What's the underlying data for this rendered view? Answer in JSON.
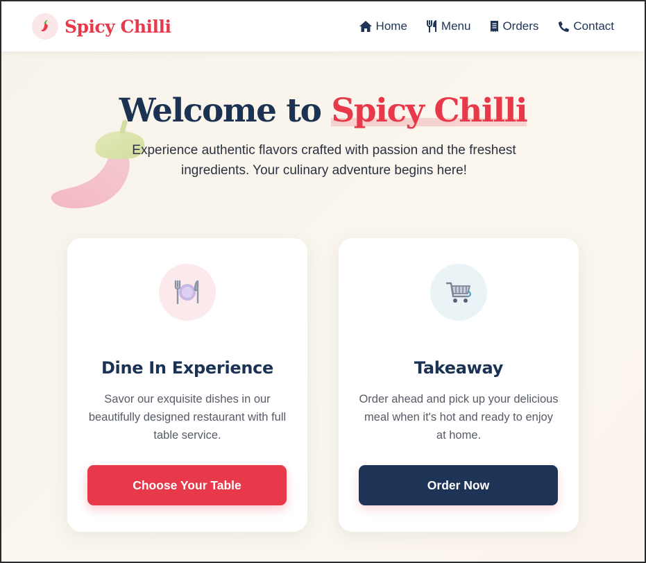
{
  "header": {
    "brand": "Spicy Chilli",
    "nav": [
      {
        "label": "Home",
        "icon": "home-icon"
      },
      {
        "label": "Menu",
        "icon": "utensils-icon"
      },
      {
        "label": "Orders",
        "icon": "receipt-icon"
      },
      {
        "label": "Contact",
        "icon": "phone-icon"
      }
    ]
  },
  "hero": {
    "title_prefix": "Welcome to",
    "title_accent": "Spicy Chilli",
    "subtitle": "Experience authentic flavors crafted with passion and the freshest ingredients. Your culinary adventure begins here!"
  },
  "cards": [
    {
      "icon": "plate-cutlery-icon",
      "title": "Dine In Experience",
      "text": "Savor our exquisite dishes in our beautifully designed restaurant with full table service.",
      "button": "Choose Your Table"
    },
    {
      "icon": "shopping-cart-icon",
      "title": "Takeaway",
      "text": "Order ahead and pick up your delicious meal when it's hot and ready to enjoy at home.",
      "button": "Order Now"
    }
  ],
  "colors": {
    "accent": "#e8394a",
    "navy": "#1e3456",
    "background": "#f8f3ea"
  }
}
